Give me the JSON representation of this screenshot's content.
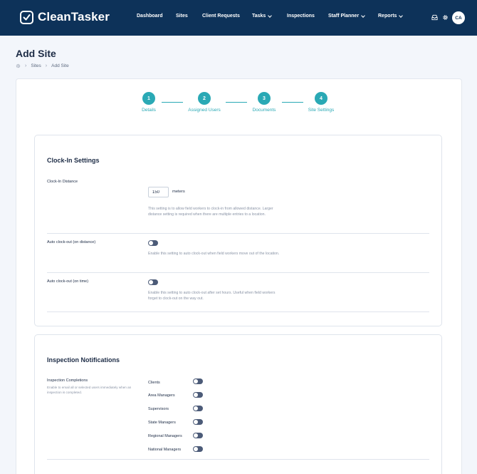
{
  "app": {
    "name": "CleanTasker"
  },
  "nav": {
    "items": [
      {
        "label": "Dashboard",
        "has_menu": false
      },
      {
        "label": "Sites",
        "has_menu": false
      },
      {
        "label": "Client Requests",
        "has_menu": false
      },
      {
        "label": "Tasks",
        "has_menu": true
      },
      {
        "label": "Inspections",
        "has_menu": false
      },
      {
        "label": "Staff Planner",
        "has_menu": true
      },
      {
        "label": "Reports",
        "has_menu": true
      }
    ],
    "icons": [
      "inbox-icon",
      "gear-icon"
    ],
    "avatar_initials": "CA"
  },
  "page": {
    "title": "Add Site",
    "breadcrumb": [
      "Sites",
      "Add Site"
    ]
  },
  "stepper": {
    "steps": [
      {
        "number": "1",
        "label": "Details"
      },
      {
        "number": "2",
        "label": "Assigned Users"
      },
      {
        "number": "3",
        "label": "Documents"
      },
      {
        "number": "4",
        "label": "Site Settings"
      }
    ],
    "color": "#2aa9b5"
  },
  "clock_in": {
    "title": "Clock-In Settings",
    "distance": {
      "label": "Clock-In Distance",
      "value": "150",
      "unit": "meters",
      "help": "This setting is to allow field workers to clock-in from allowed distance. Larger distance setting is required when there are multiple entries to a location."
    },
    "auto_distance": {
      "label": "Auto clock-out (on distance)",
      "enabled": false,
      "help": "Enable this setting to auto clock-out when field workers move out of the location."
    },
    "auto_time": {
      "label": "Auto clock-out (on time)",
      "enabled": false,
      "help": "Enable this setting to auto clock-out after set hours. Useful when field workers forget to clock-out on the way out."
    }
  },
  "inspection": {
    "title": "Inspection Notifications",
    "completions_label": "Inspection Completions",
    "completions_help": "Enable to email all or selected users immediately when an inspection is completed.",
    "roles": [
      {
        "label": "Clients",
        "enabled": false
      },
      {
        "label": "Area Managers",
        "enabled": false
      },
      {
        "label": "Supervisors",
        "enabled": false
      },
      {
        "label": "State Managers",
        "enabled": false
      },
      {
        "label": "Regional Managers",
        "enabled": false
      },
      {
        "label": "National Managers",
        "enabled": false
      }
    ]
  },
  "colors": {
    "nav_bg": "#0d3259",
    "accent": "#2aa9b5",
    "toggle_off": "#4c5b78"
  }
}
